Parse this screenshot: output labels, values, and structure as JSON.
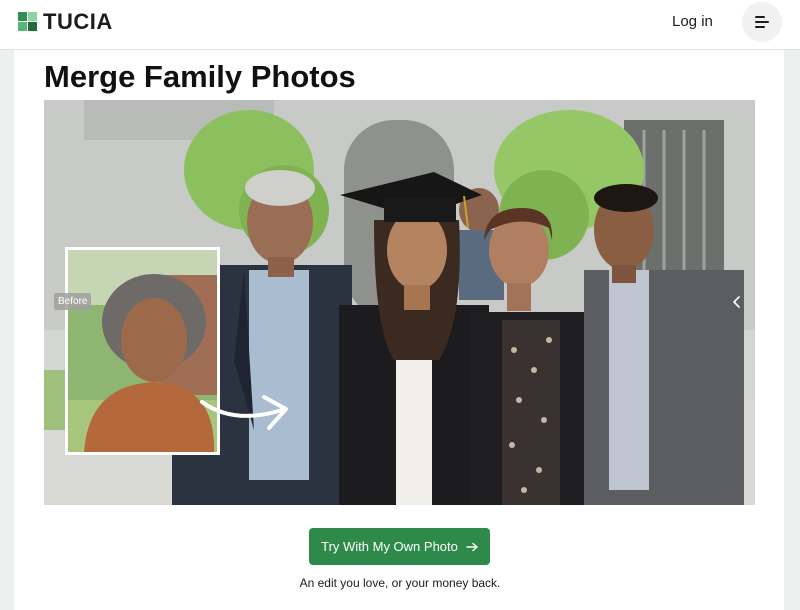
{
  "brand": {
    "name": "TUCIA"
  },
  "header": {
    "login_label": "Log in",
    "menu_icon": "hamburger-menu-icon"
  },
  "page": {
    "title": "Merge Family Photos"
  },
  "hero": {
    "before_label": "Before",
    "nav_icon": "chevron-left-icon"
  },
  "cta": {
    "label": "Try With My Own Photo",
    "icon": "arrow-right-icon"
  },
  "guarantee": "An edit you love, or your money back.",
  "colors": {
    "brand_green": "#2e8a4b",
    "text_dark": "#111111",
    "page_bg": "#eef0ef"
  }
}
